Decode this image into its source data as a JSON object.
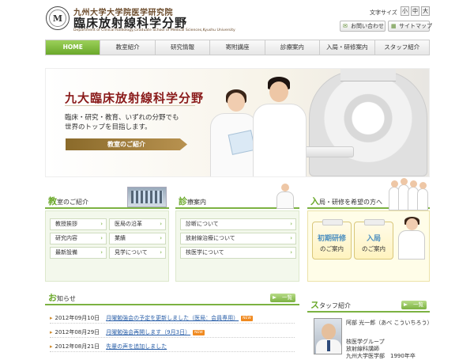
{
  "header": {
    "emblem_letter": "M",
    "university_line": "九州大学大学院医学研究院",
    "site_title": "臨床放射線科学分野",
    "english_title": "Department of Clinical Radiology,Graduate School of Medical Sciences,Kyushu University",
    "font_size_label": "文字サイズ",
    "font_sizes": [
      "小",
      "中",
      "大"
    ],
    "contact_label": "お問い合わせ",
    "sitemap_label": "サイトマップ"
  },
  "nav": [
    "HOME",
    "教室紹介",
    "研究情報",
    "寄附講座",
    "診療案内",
    "入局・研修案内",
    "スタッフ紹介"
  ],
  "hero": {
    "title": "九大臨床放射線科学分野",
    "tagline_1": "臨床・研究・教育、いずれの分野でも",
    "tagline_2": "世界のトップを目指します。",
    "button_label": "教室のご紹介"
  },
  "panel_lab": {
    "first_char": "教",
    "rest": "室のご紹介",
    "items": [
      "教授挨拶",
      "医局の沿革",
      "研究内容",
      "業績",
      "最新設備",
      "見学について"
    ]
  },
  "panel_clinical": {
    "first_char": "診",
    "rest": "療案内",
    "items": [
      "診断について",
      "放射線治療について",
      "核医学について"
    ]
  },
  "panel_join": {
    "first_char": "入",
    "rest": "局・研修を希望の方へ",
    "btn_training_1": "初期研修",
    "btn_training_2": "のご案内",
    "btn_join_1": "入局",
    "btn_join_2": "のご案内"
  },
  "news": {
    "first_char": "お",
    "rest": "知らせ",
    "more_label": "一覧",
    "items": [
      {
        "date": "2012年09月10日",
        "title": "月曜勉強会の予定を更新しました（医局：会員専用）",
        "is_new": true
      },
      {
        "date": "2012年08月29日",
        "title": "月曜勉強会再開します（9月3日）",
        "is_new": true
      },
      {
        "date": "2012年08月21日",
        "title": "先輩の声を追加しました",
        "is_new": false
      }
    ],
    "new_badge": "NEW"
  },
  "staff": {
    "first_char": "ス",
    "rest": "タッフ紹介",
    "more_label": "一覧",
    "name": "阿部 光一郎（あべ こういちろう）",
    "line_1": "核医学グループ",
    "line_2": "放射線科講師",
    "line_3": "九州大学医学部　1990年卒"
  },
  "colors": {
    "accent_green": "#7cb242",
    "title_red": "#8a1a1a",
    "link_blue": "#2a5fa8"
  }
}
